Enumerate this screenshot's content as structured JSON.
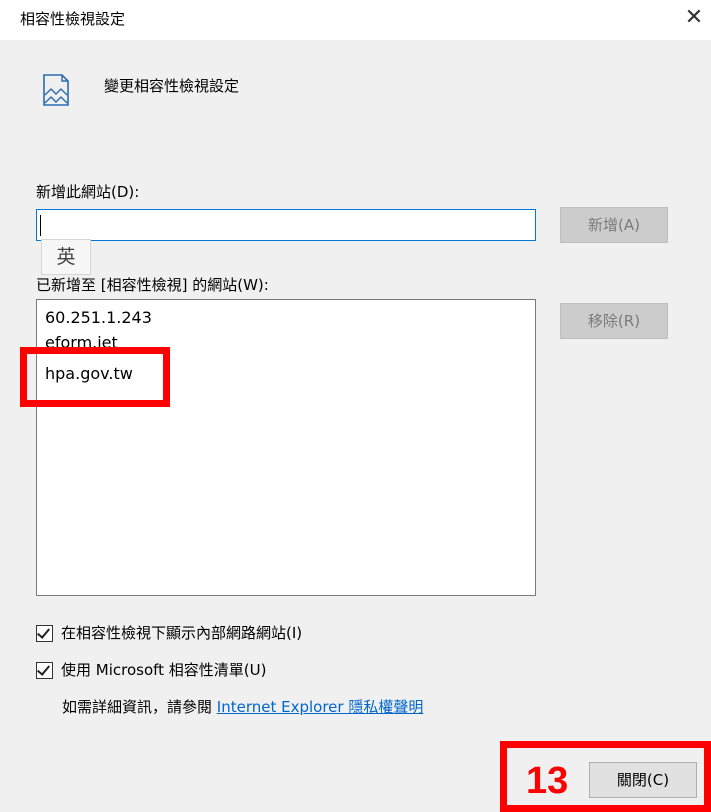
{
  "dialog": {
    "title": "相容性檢視設定",
    "close_glyph": "✕",
    "heading": "變更相容性檢視設定",
    "heading_icon": "document-icon"
  },
  "add_site": {
    "label": "新增此網站(D):",
    "value": "",
    "add_button": "新增(A)",
    "ime_indicator": "英"
  },
  "site_list": {
    "label": "已新增至 [相容性檢視] 的網站(W):",
    "items": [
      "60.251.1.243",
      "eform.iet",
      "hpa.gov.tw"
    ],
    "remove_button": "移除(R)"
  },
  "options": {
    "show_intranet": {
      "label": "在相容性檢視下顯示內部網路網站(I)",
      "checked": true
    },
    "use_ms_list": {
      "label": "使用 Microsoft 相容性清單(U)",
      "checked": true
    }
  },
  "info": {
    "text": "如需詳細資訊，請參閱 ",
    "link": "Internet Explorer 隱私權聲明"
  },
  "footer": {
    "close_button": "關閉(C)"
  },
  "annotation": {
    "step_number": "13",
    "highlight_color": "#ff0000"
  }
}
